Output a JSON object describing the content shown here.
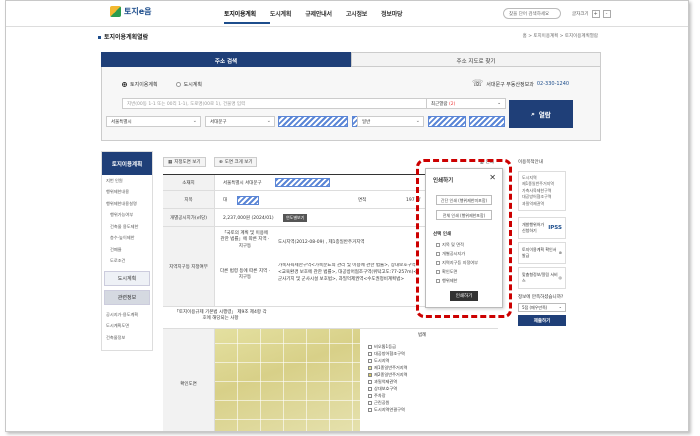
{
  "header": {
    "logo": "토지e음",
    "nav": [
      "토지이용계획",
      "도시계획",
      "규제안내서",
      "고시정보",
      "정보마당"
    ],
    "search_placeholder": "찾을 단어 검색하세요",
    "font_size_label": "글자크기",
    "font_plus": "+",
    "font_minus": "-"
  },
  "page": {
    "title": "토지이용계획열람",
    "breadcrumb": "홈 > 토지이용계획 > 토지이용계획열람"
  },
  "tabs": {
    "address_search": "주소 검색",
    "map_search": "주소 지도로 찾기"
  },
  "search": {
    "radio_land": "토지이용계획",
    "radio_city": "도시계획",
    "phone_label": "서대문구 부동산정보과",
    "phone_number": "02-330-1240",
    "input_placeholder": "지번(00동 1-1 또는 00리 1-1), 도로명(00로 1), 건물명 입력",
    "recent_label": "최근열람",
    "recent_count": "(2)",
    "sido": "서울특별시",
    "sigungu": "서대문구",
    "bunji_type": "일반",
    "view_button": "열람"
  },
  "sidebar": {
    "head": "토지이용계획",
    "items": [
      "지번 인원",
      "행위제한내용",
      "행위제한내용설명"
    ],
    "sub_items": [
      "행위가능여부",
      "건축물 용도제한",
      "층수·높이제한",
      "건폐율",
      "도로조건"
    ],
    "btn_city": "도시계획",
    "btn_related": "관련정보",
    "bottom_items": [
      "공시지가·용도계획",
      "도시계획도면",
      "건축물정보"
    ]
  },
  "toolbar": {
    "wide_map": "지정도면 보기",
    "map_print": "도면 크게 보기",
    "print": "인쇄"
  },
  "info": {
    "location_label": "소재지",
    "location_value": "서울특별시 서대문구",
    "jimok_label": "지목",
    "jimok_value": "대",
    "area_label": "면적",
    "area_value": "197 ㎡",
    "price_label": "개별공시지가(㎡당)",
    "price_value": "2,237,000원 (2024/01)",
    "price_btn": "연도별보기",
    "zoning_label": "지역지구등 지정여부",
    "zoning_sub1": "「국토의 계획 및 이용에 관한 법률」에 따른 지역 · 지구등",
    "zoning_val1": "도시지역(2012-08-09) , 제1종일반주거지역",
    "zoning_sub2": "다른 법령 등에 따른 지역 · 지구등",
    "zoning_val2": "가축사육제한구역<가축분뇨의 관리 및 이용에 관한 법률>, 상대보호구역<교육환경 보호에 관한 법률>, 대공방어협조구역(위탁고도:77-257m)<군사기지 및 군사시설 보호법>, 과밀억제권역<수도권정비계획법>",
    "enforce_label": "「토지이용규제 기본법 시행령」 제9조 제4항 각 호에 해당되는 사항",
    "map_label": "확인도면",
    "legend_title": "범례",
    "legend": [
      "비오톱1등급",
      "대공방어협조구역",
      "도시지역",
      "제1종일반주거지역",
      "제2종일반주거지역",
      "과밀억제권역",
      "상대보호구역",
      "주차장",
      "근린공원",
      "도시지역연결구역"
    ]
  },
  "print_modal": {
    "title": "인쇄하기",
    "close": "✕",
    "btn_simple": "간단 인쇄 (행위제한미포함)",
    "btn_full": "전체 인쇄 (행위제한포함)",
    "select_title": "선택 인쇄",
    "options": [
      "지목 및 면적",
      "개별공시지가",
      "지역지구등 지정여부",
      "확인도면",
      "행위제한"
    ],
    "print_btn": "인쇄하기"
  },
  "right": {
    "title": "이용목적안내",
    "list": [
      "도시지역",
      "제1종일반주거지역",
      "가축사육제한구역",
      "대공방어협조구역",
      "과밀억제권역"
    ],
    "box1": "개발행위허가 신청하기",
    "box1_icon": "IPSS",
    "box2": "토지이용계획 확인서 발급",
    "box3": "맞춤형정보/알림 서비스",
    "survey_q": "정보에 만족하셨습니까?",
    "survey_opt": "5점 (매우만족)",
    "survey_btn": "제출하기"
  }
}
